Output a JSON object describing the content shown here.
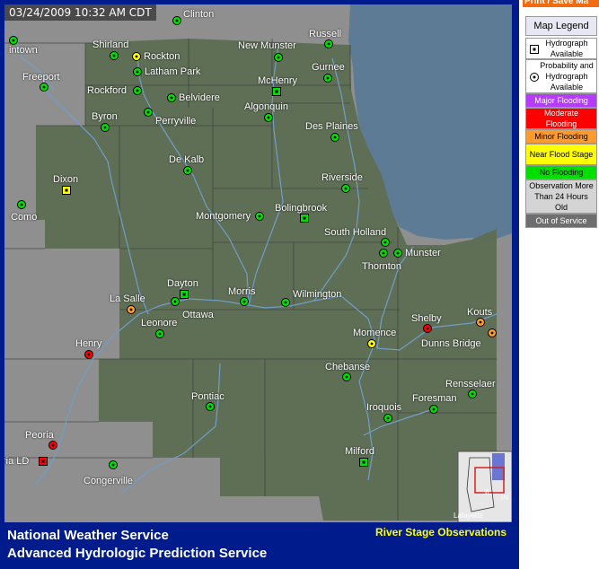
{
  "header": {
    "timestamp": "03/24/2009 10:32 AM CDT",
    "print_label": "Print / Save Ma"
  },
  "footer": {
    "title": "National Weather Service",
    "subtitle": "Advanced Hydrologic Prediction Service",
    "observations": "River Stage Observations"
  },
  "legend": {
    "title": "Map Legend",
    "items": [
      {
        "label": "Hydrograph Available",
        "bg": "#ffffff",
        "fg": "#000000",
        "icon": "square-dot"
      },
      {
        "label": "Probability and Hydrograph Available",
        "bg": "#ffffff",
        "fg": "#000000",
        "icon": "circle-dot"
      },
      {
        "label": "Major Flooding",
        "bg": "#b53cff",
        "fg": "#ffffff"
      },
      {
        "label": "Moderate Flooding",
        "bg": "#ff0000",
        "fg": "#ffffff"
      },
      {
        "label": "Minor Flooding",
        "bg": "#ff9a2e",
        "fg": "#000000"
      },
      {
        "label": "Near Flood Stage",
        "bg": "#ffff00",
        "fg": "#000000"
      },
      {
        "label": "No Flooding",
        "bg": "#00e000",
        "fg": "#000000"
      },
      {
        "label": "Observation More Than 24 Hours Old",
        "bg": "#d4d4d4",
        "fg": "#000000"
      },
      {
        "label": "Out of Service",
        "bg": "#6e6e6e",
        "fg": "#ffffff"
      }
    ]
  },
  "status_colors": {
    "no_flood": "#00e000",
    "near": "#ffff00",
    "minor": "#ff9a2e",
    "moderate": "#ff0000"
  },
  "stations": [
    {
      "name": "Clinton",
      "status": "no_flood"
    },
    {
      "name": "intown",
      "status": "no_flood"
    },
    {
      "name": "Shirland",
      "status": "no_flood"
    },
    {
      "name": "Rockton",
      "status": "near"
    },
    {
      "name": "New Munster",
      "status": "no_flood"
    },
    {
      "name": "Russell",
      "status": "no_flood"
    },
    {
      "name": "Latham Park",
      "status": "no_flood"
    },
    {
      "name": "Freeport",
      "status": "no_flood"
    },
    {
      "name": "Gurnee",
      "status": "no_flood"
    },
    {
      "name": "McHenry",
      "status": "no_flood"
    },
    {
      "name": "Rockford",
      "status": "no_flood"
    },
    {
      "name": "Belvidere",
      "status": "no_flood"
    },
    {
      "name": "Algonquin",
      "status": "no_flood"
    },
    {
      "name": "Perryville",
      "status": "no_flood"
    },
    {
      "name": "Byron",
      "status": "no_flood"
    },
    {
      "name": "Des Plaines",
      "status": "no_flood"
    },
    {
      "name": "De Kalb",
      "status": "no_flood"
    },
    {
      "name": "Dixon",
      "status": "near"
    },
    {
      "name": "Riverside",
      "status": "no_flood"
    },
    {
      "name": "Como",
      "status": "no_flood"
    },
    {
      "name": "Bolingbrook",
      "status": "no_flood"
    },
    {
      "name": "Montgomery",
      "status": "no_flood"
    },
    {
      "name": "South Holland",
      "status": "no_flood"
    },
    {
      "name": "Munster",
      "status": "no_flood"
    },
    {
      "name": "Thornton",
      "status": "no_flood"
    },
    {
      "name": "Dayton",
      "status": "no_flood"
    },
    {
      "name": "Morris",
      "status": "no_flood"
    },
    {
      "name": "Wilmington",
      "status": "no_flood"
    },
    {
      "name": "La Salle",
      "status": "minor"
    },
    {
      "name": "Ottawa",
      "status": "no_flood"
    },
    {
      "name": "Kouts",
      "status": "minor"
    },
    {
      "name": "Shelby",
      "status": "moderate"
    },
    {
      "name": "Leonore",
      "status": "no_flood"
    },
    {
      "name": "Momence",
      "status": "near"
    },
    {
      "name": "Dunns Bridge",
      "status": "minor"
    },
    {
      "name": "Henry",
      "status": "moderate"
    },
    {
      "name": "Chebanse",
      "status": "no_flood"
    },
    {
      "name": "Rensselaer",
      "status": "no_flood"
    },
    {
      "name": "Pontiac",
      "status": "no_flood"
    },
    {
      "name": "Foresman",
      "status": "no_flood"
    },
    {
      "name": "Iroquois",
      "status": "no_flood"
    },
    {
      "name": "Peoria",
      "status": "moderate"
    },
    {
      "name": "ria LD",
      "status": "moderate"
    },
    {
      "name": "Milford",
      "status": "no_flood"
    },
    {
      "name": "Congerville",
      "status": "no_flood"
    }
  ],
  "inset": {
    "labels": [
      "IL",
      "IN",
      "Lafayette"
    ]
  }
}
